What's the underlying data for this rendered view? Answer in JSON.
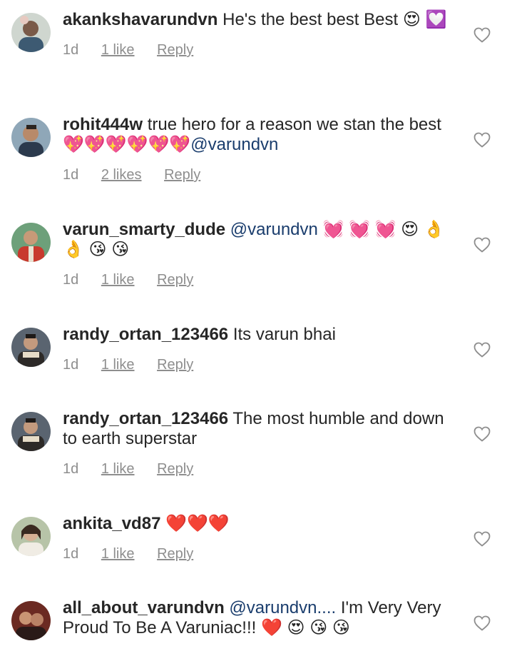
{
  "colors": {
    "text": "#262626",
    "meta": "#8e8e8e",
    "mention": "#1a3d6d",
    "heart_outline": "#8e8e8e"
  },
  "comments": [
    {
      "username": "akankshavarundvn",
      "text": "He's the best best Best",
      "emoji": "😍 💟",
      "mention": "",
      "time": "1d",
      "likes": "1 like",
      "reply": "Reply"
    },
    {
      "username": "rohit444w",
      "text": "true hero for a reason we stan the best",
      "emoji": "💖💖💖💖💖💖",
      "mention": "@varundvn",
      "time": "1d",
      "likes": "2 likes",
      "reply": "Reply"
    },
    {
      "username": "varun_smarty_dude",
      "text": "",
      "mention": "@varundvn",
      "emoji": "💓 💓 💓 😍 👌 👌 😘 😘",
      "time": "1d",
      "likes": "1 like",
      "reply": "Reply"
    },
    {
      "username": "randy_ortan_123466",
      "text": "Its varun bhai",
      "emoji": "",
      "mention": "",
      "time": "1d",
      "likes": "1 like",
      "reply": "Reply"
    },
    {
      "username": "randy_ortan_123466",
      "text": "The most humble and down to earth superstar",
      "emoji": "",
      "mention": "",
      "time": "1d",
      "likes": "1 like",
      "reply": "Reply"
    },
    {
      "username": "ankita_vd87",
      "text": "",
      "emoji": "❤️❤️❤️",
      "mention": "",
      "time": "1d",
      "likes": "1 like",
      "reply": "Reply"
    },
    {
      "username": "all_about_varundvn",
      "mention": "@varundvn....",
      "text": "I'm Very Very Proud To Be A Varuniac!!!",
      "emoji": "❤️ 😍 😘 😘",
      "time": "",
      "likes": "",
      "reply": ""
    }
  ]
}
